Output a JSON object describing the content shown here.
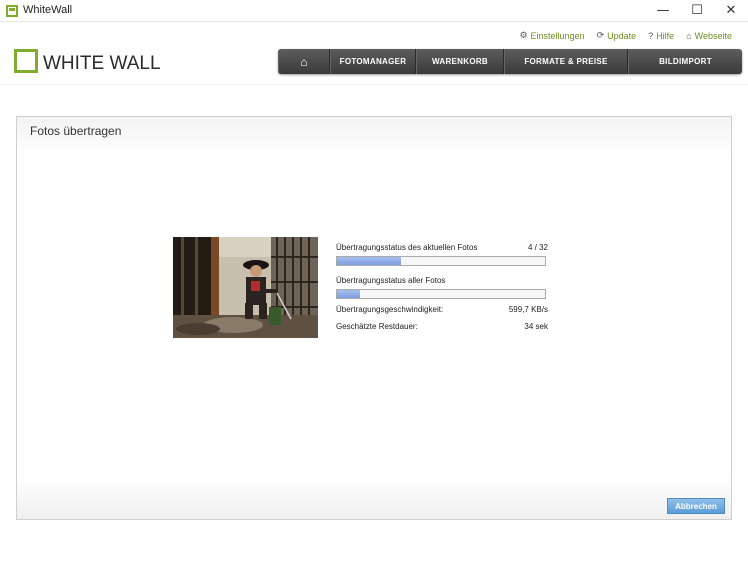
{
  "window": {
    "title": "WhiteWall",
    "controls": {
      "minimize": "—",
      "maximize": "☐",
      "close": "✕"
    }
  },
  "header": {
    "logo_text": "WHITE WALL",
    "top_links": [
      {
        "label": "Einstellungen",
        "icon": "gear-icon",
        "glyph": "⚙"
      },
      {
        "label": "Update",
        "icon": "update-icon",
        "glyph": "⟳"
      },
      {
        "label": "Hilfe",
        "icon": "help-icon",
        "glyph": "?"
      },
      {
        "label": "Webseite",
        "icon": "home-icon",
        "glyph": "⌂"
      }
    ],
    "nav": [
      {
        "label": "⌂",
        "icon": "home-icon"
      },
      {
        "label": "FOTOMANAGER"
      },
      {
        "label": "WARENKORB"
      },
      {
        "label": "FORMATE & PREISE"
      },
      {
        "label": "BILDIMPORT"
      }
    ]
  },
  "panel": {
    "title": "Fotos übertragen",
    "current_label": "Übertragungsstatus des aktuellen Fotos",
    "current_value": "4 / 32",
    "current_progress": 0.31,
    "all_label": "Übertragungsstatus aller Fotos",
    "all_progress": 0.11,
    "speed_label": "Übertragungsgeschwindigkeit:",
    "speed_value": "599,7 KB/s",
    "remaining_label": "Geschätzte Restdauer:",
    "remaining_value": "34 sek",
    "cancel_label": "Abbrechen"
  },
  "colors": {
    "brand_green": "#7fae2e",
    "link_green": "#6b8f1f",
    "nav_dark": "#3a3a3a",
    "progress_blue": "#7e9ee0",
    "button_blue": "#5c9dd6"
  }
}
